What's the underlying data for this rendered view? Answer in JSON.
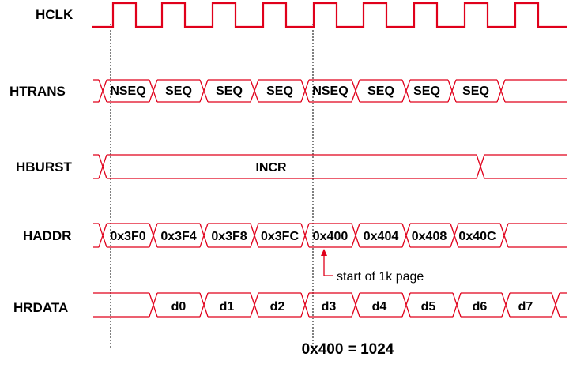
{
  "signals": {
    "hclk": "HCLK",
    "htrans": "HTRANS",
    "hburst": "HBURST",
    "haddr": "HADDR",
    "hrdata": "HRDATA"
  },
  "htrans_values": [
    "NSEQ",
    "SEQ",
    "SEQ",
    "SEQ",
    "NSEQ",
    "SEQ",
    "SEQ",
    "SEQ"
  ],
  "hburst_value": "INCR",
  "haddr_values": [
    "0x3F0",
    "0x3F4",
    "0x3F8",
    "0x3FC",
    "0x400",
    "0x404",
    "0x408",
    "0x40C"
  ],
  "hrdata_values": [
    "d0",
    "d1",
    "d2",
    "d3",
    "d4",
    "d5",
    "d6",
    "d7"
  ],
  "annotation": "start of 1k page",
  "footer": "0x400 = 1024",
  "colors": {
    "waveform": "#e0001b",
    "text": "#000000"
  }
}
